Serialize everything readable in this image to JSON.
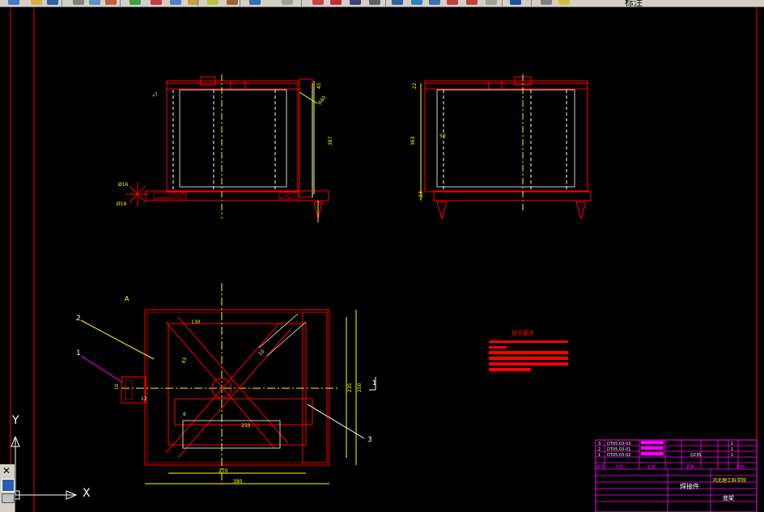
{
  "toolbar": {
    "layer_label": "标注",
    "buttons": [
      "new-icon",
      "open-icon",
      "save-icon",
      "print-icon",
      "preview-icon",
      "plot-icon",
      "spell-icon",
      "cut-icon",
      "copy-icon",
      "paste-icon",
      "matchprop-icon",
      "brush-icon",
      "undo-icon",
      "redo-icon",
      "pan-icon",
      "zoom-realtime-icon",
      "zoom-window-icon",
      "zoom-previous-icon",
      "properties-icon",
      "designcenter-icon",
      "toolpalette-icon",
      "sheetset-icon",
      "markup-icon",
      "calc-icon",
      "help-icon",
      "layers-icon",
      "layer-state-icon"
    ]
  },
  "dock": {
    "close_glyph": "✕"
  },
  "ucs": {
    "y_label": "Y",
    "x_label": "X"
  },
  "annotations": {
    "view_label_a": "A",
    "part_1": "1",
    "part_2": "2",
    "part_3": "3",
    "section_mark": "1"
  },
  "dimensions": {
    "front_height": "387",
    "side_height": "363",
    "top_width_overall": "380",
    "top_width_inner": "270",
    "top_height_overall": "250",
    "top_height_inner": "235",
    "brace_len": "250",
    "dim_130": "130",
    "dim_10a": "10",
    "dim_10b": "10",
    "dim_22": "22",
    "dim_45": "45",
    "dim_23": "23",
    "dim_16": "Ø16",
    "dim_019": "Ø19",
    "dim_40": "R40",
    "dim_50": "50",
    "dim_43": "43",
    "dim_12": "12",
    "dim_6": "6"
  },
  "notes": {
    "title": "技术要求"
  },
  "title_block": {
    "rows": [
      {
        "no": "3",
        "code": "DT05.03-03"
      },
      {
        "no": "2",
        "code": "DT05.03-01"
      },
      {
        "no": "1",
        "code": "DT05.03-02"
      }
    ],
    "header": {
      "seq": "序号",
      "code": "代号",
      "name": "名称",
      "qty": "数量",
      "material": "材料"
    },
    "part_name": "焊接件",
    "school": "河北理工科学院",
    "drawing": "底架",
    "mid_values": [
      "Q235"
    ],
    "side_values": [
      "1",
      "1",
      "1"
    ]
  },
  "colors": {
    "red": "#ff0000",
    "yellow": "#ffff00",
    "white": "#ffffff",
    "magenta": "#ff00ff",
    "green": "#00ff00",
    "toolbar_bg": "#d4d0c8"
  }
}
